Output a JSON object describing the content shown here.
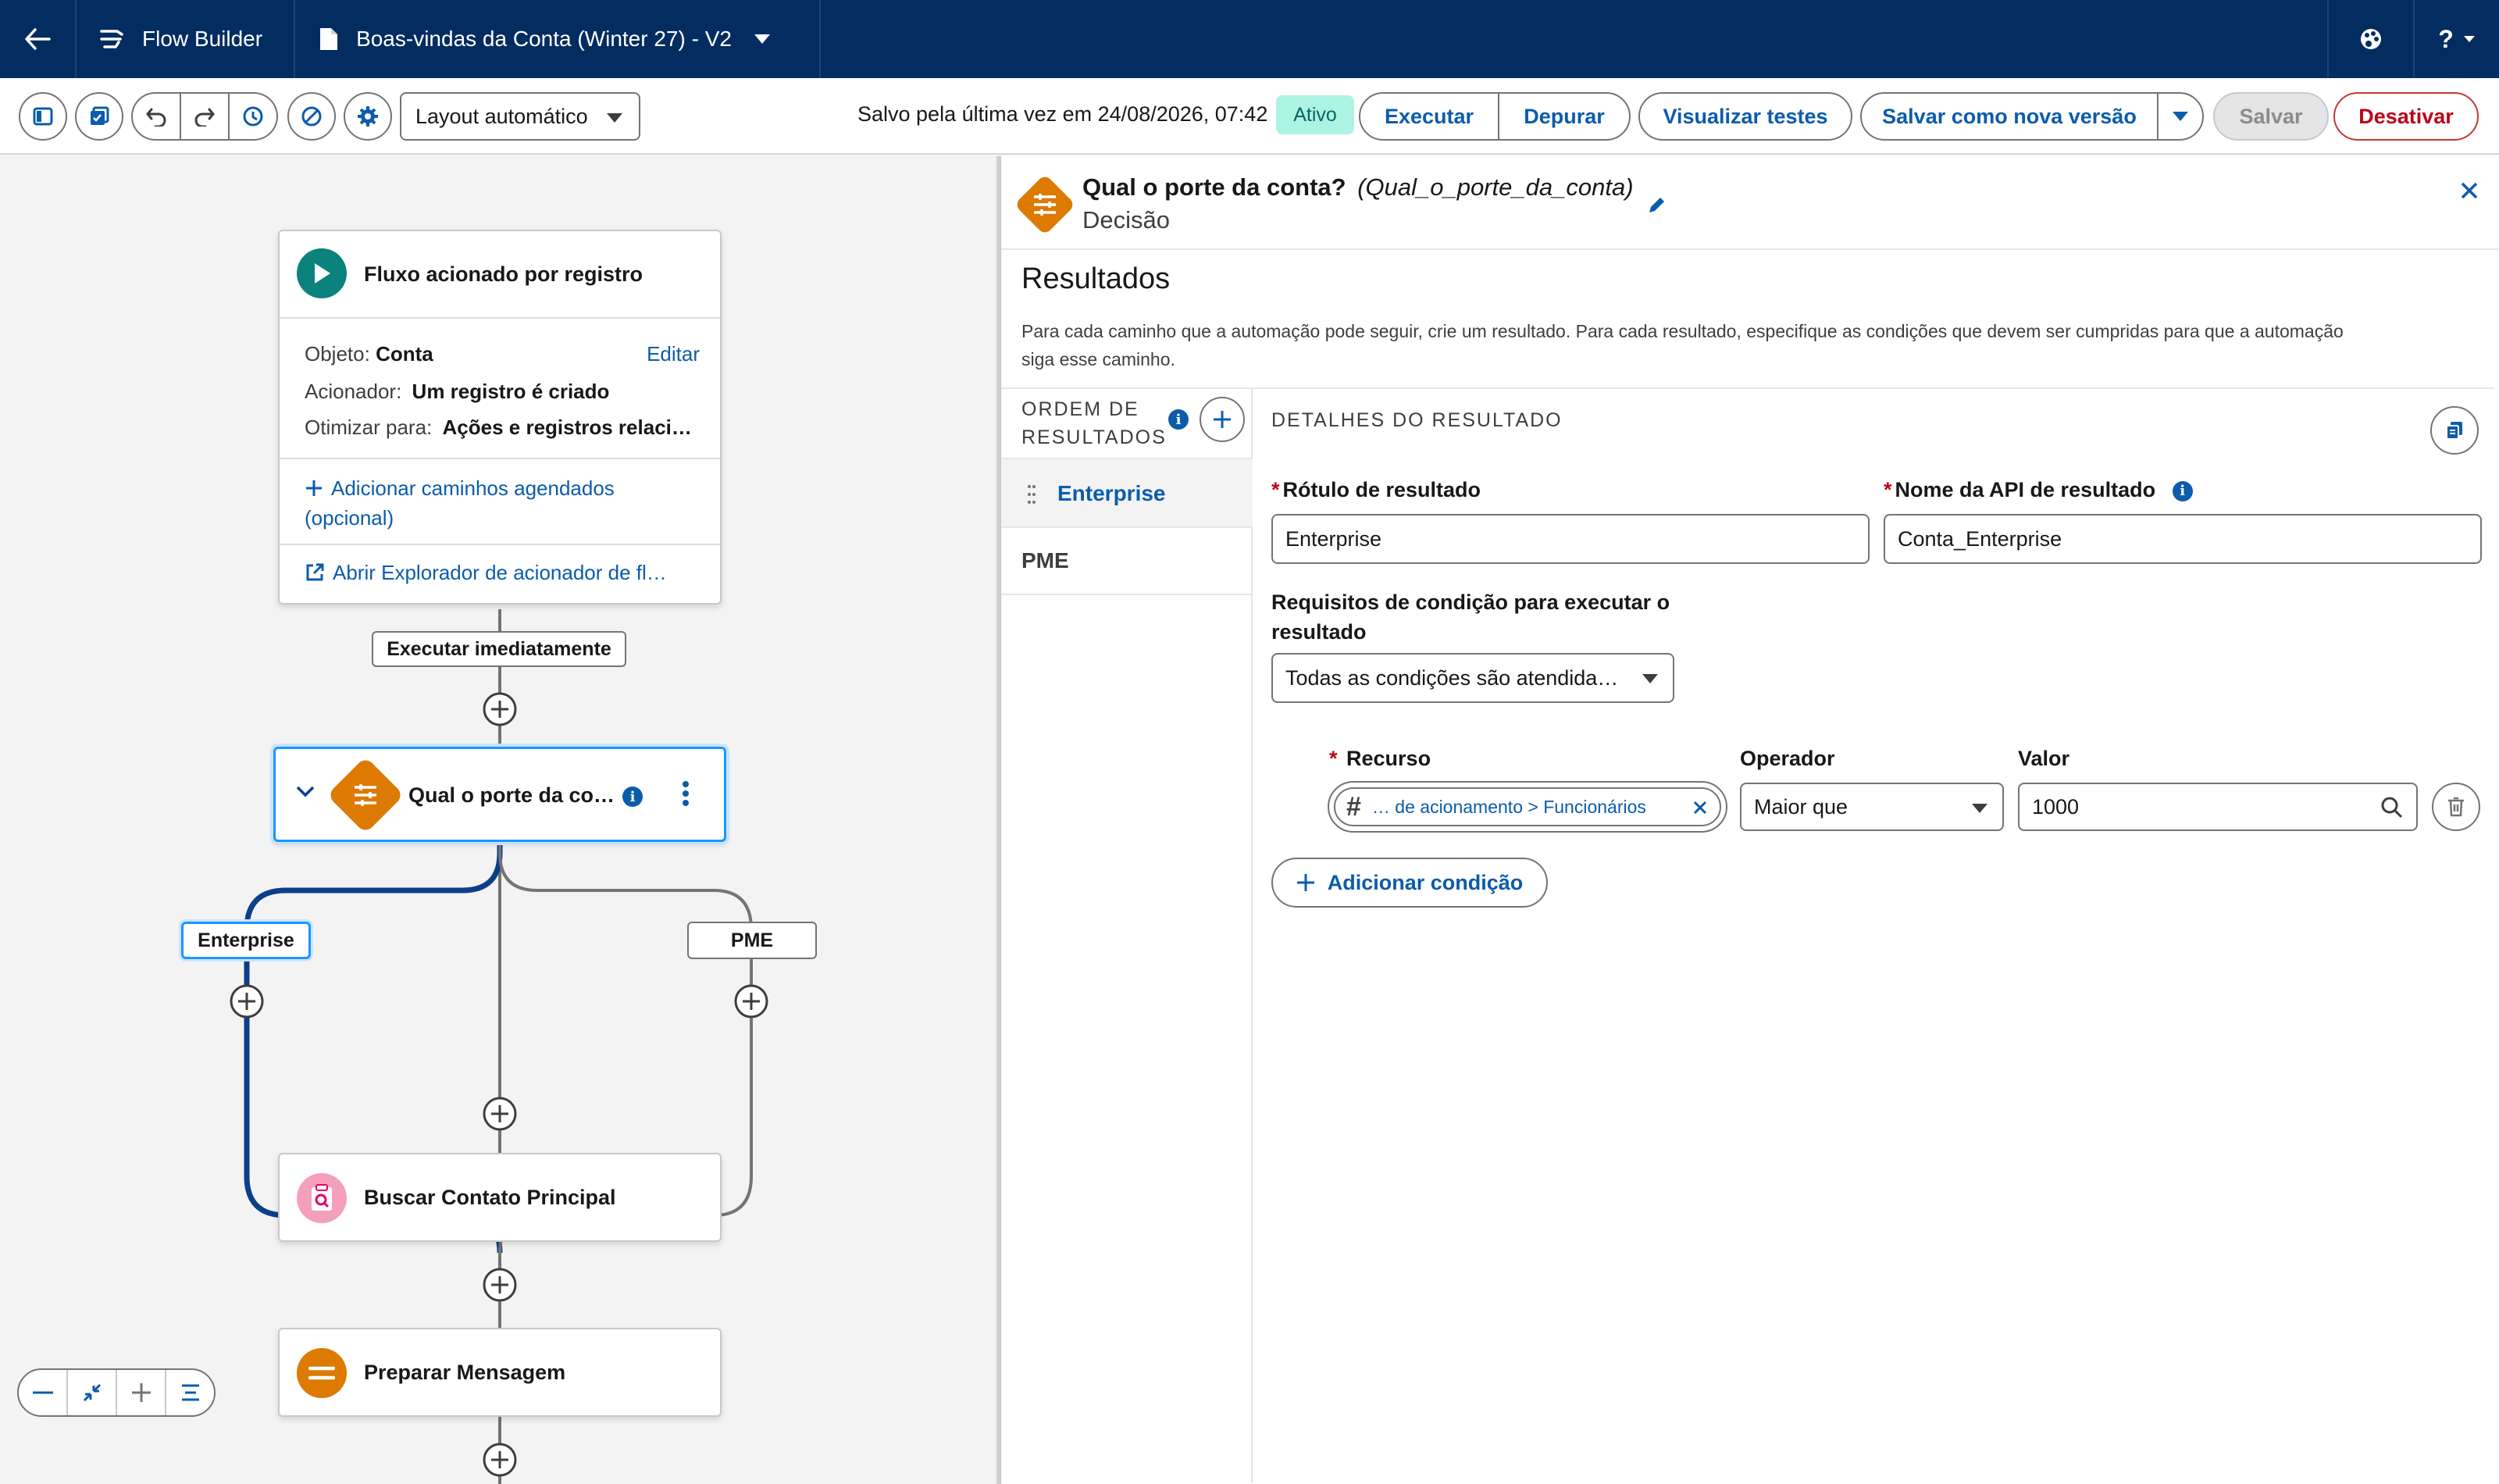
{
  "header": {
    "app_name": "Flow Builder",
    "flow_name": "Boas-vindas da Conta (Winter 27) - V2",
    "help_label": "?"
  },
  "toolbar": {
    "layout_select": "Layout automático",
    "saved_text": "Salvo pela última vez em 24/08/2026, 07:42",
    "status_badge": "Ativo",
    "run_label": "Executar",
    "debug_label": "Depurar",
    "view_tests_label": "Visualizar testes",
    "save_as_new_label": "Salvar como nova versão",
    "save_label": "Salvar",
    "deactivate_label": "Desativar"
  },
  "canvas": {
    "start": {
      "title": "Fluxo acionado por registro",
      "object_label": "Objeto:",
      "object_value": "Conta",
      "edit_label": "Editar",
      "trigger_label": "Acionador:",
      "trigger_value": "Um registro é criado",
      "optimize_label": "Otimizar para:",
      "optimize_value": "Ações e registros relaci…",
      "add_paths_line1": "Adicionar caminhos agendados",
      "add_paths_line2": "(opcional)",
      "open_explorer": "Abrir Explorador de acionador de fl…"
    },
    "run_immediately": "Executar imediatamente",
    "decision_title": "Qual o porte da co…",
    "branch_enterprise": "Enterprise",
    "branch_pme": "PME",
    "lookup_title": "Buscar Contato Principal",
    "assign_title": "Preparar Mensagem"
  },
  "panel": {
    "title": "Qual o porte da conta?",
    "api_name": "(Qual_o_porte_da_conta)",
    "subtitle": "Decisão",
    "section_title": "Resultados",
    "description_line1": "Para cada caminho que a automação pode seguir, crie um resultado. Para cada resultado, especifique as condições que devem ser cumpridas para que a automação",
    "description_line2": "siga esse caminho.",
    "order_label_line1": "ORDEM DE",
    "order_label_line2": "RESULTADOS",
    "outcomes": [
      "Enterprise",
      "PME"
    ],
    "details_label": "DETALHES DO RESULTADO",
    "label_field_label": "Rótulo de resultado",
    "label_field_value": "Enterprise",
    "api_field_label": "Nome da API de resultado",
    "api_field_value": "Conta_Enterprise",
    "requirements_line1": "Requisitos de condição para executar o",
    "requirements_line2": "resultado",
    "requirements_value": "Todas as condições são atendida…",
    "resource_label": "Recurso",
    "operator_label": "Operador",
    "value_label": "Valor",
    "resource_value": "… de acionamento > Funcionários",
    "operator_value": "Maior que",
    "value_value": "1000",
    "add_condition": "Adicionar condição"
  },
  "colors": {
    "header_bg": "#032d60",
    "brand_blue": "#0b5cab",
    "decision_orange": "#dd7a01",
    "start_teal": "#0b827c",
    "lookup_pink": "#f4a0bd",
    "connector_selected": "#0b3f8a"
  }
}
